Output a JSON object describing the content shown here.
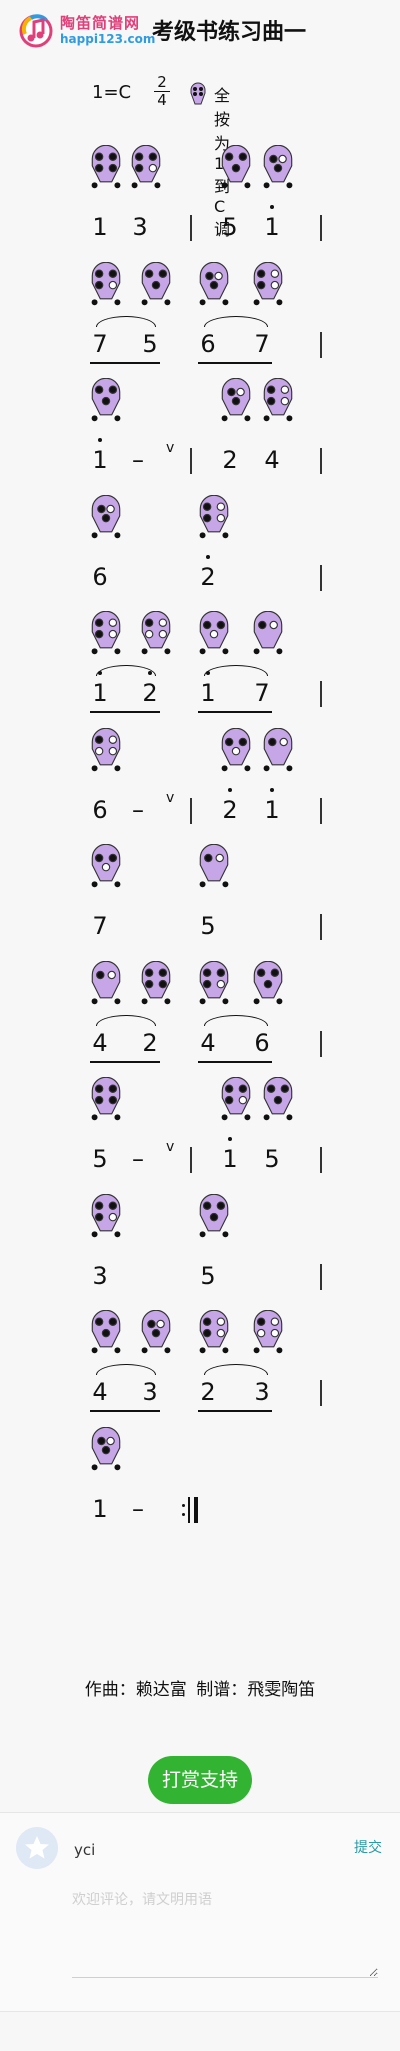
{
  "header": {
    "logo_cn": "陶笛简谱网",
    "logo_en": "happi123.com",
    "title": "考级书练习曲一"
  },
  "score_info": {
    "key": "1=C",
    "time_sig_top": "2",
    "time_sig_bottom": "4",
    "range_note": "全按为1 到C调"
  },
  "rows": [
    {
      "notes": [
        [
          "1",
          false
        ],
        [
          "3",
          false
        ],
        [
          "5",
          false
        ],
        [
          "1",
          true
        ]
      ]
    },
    {
      "notes": [
        [
          "7",
          false
        ],
        [
          "5",
          false
        ],
        [
          "6",
          false
        ],
        [
          "7",
          false
        ]
      ]
    },
    {
      "notes": [
        [
          "1",
          true
        ],
        [
          "2",
          false
        ],
        [
          "4",
          false
        ]
      ]
    },
    {
      "notes": [
        [
          "6",
          false
        ],
        [
          "2",
          true
        ]
      ]
    },
    {
      "notes": [
        [
          "1",
          true
        ],
        [
          "2",
          true
        ],
        [
          "1",
          true
        ],
        [
          "7",
          false
        ]
      ]
    },
    {
      "notes": [
        [
          "6",
          false
        ],
        [
          "2",
          true
        ],
        [
          "1",
          true
        ]
      ]
    },
    {
      "notes": [
        [
          "7",
          false
        ],
        [
          "5",
          false
        ]
      ]
    },
    {
      "notes": [
        [
          "4",
          false
        ],
        [
          "2",
          false
        ],
        [
          "4",
          false
        ],
        [
          "6",
          false
        ]
      ]
    },
    {
      "notes": [
        [
          "5",
          false
        ],
        [
          "1",
          true
        ],
        [
          "5",
          false
        ]
      ]
    },
    {
      "notes": [
        [
          "3",
          false
        ],
        [
          "5",
          false
        ]
      ]
    },
    {
      "notes": [
        [
          "4",
          false
        ],
        [
          "3",
          false
        ],
        [
          "2",
          false
        ],
        [
          "3",
          false
        ]
      ]
    },
    {
      "notes": [
        [
          "1",
          false
        ]
      ]
    }
  ],
  "symbols": {
    "dash": "–",
    "breath": "v"
  },
  "credits": {
    "composer": "作曲：赖达富",
    "arranger": "制谱：飛雯陶笛"
  },
  "tip_button": "打赏支持",
  "comment": {
    "username": "yci",
    "submit_label": "提交",
    "placeholder": "欢迎评论，请文明用语"
  },
  "colors": {
    "ocarina_fill": "#c7a6e8",
    "tip_button": "#32b432",
    "logo_pink": "#e0407a",
    "logo_blue": "#2f9be0"
  }
}
